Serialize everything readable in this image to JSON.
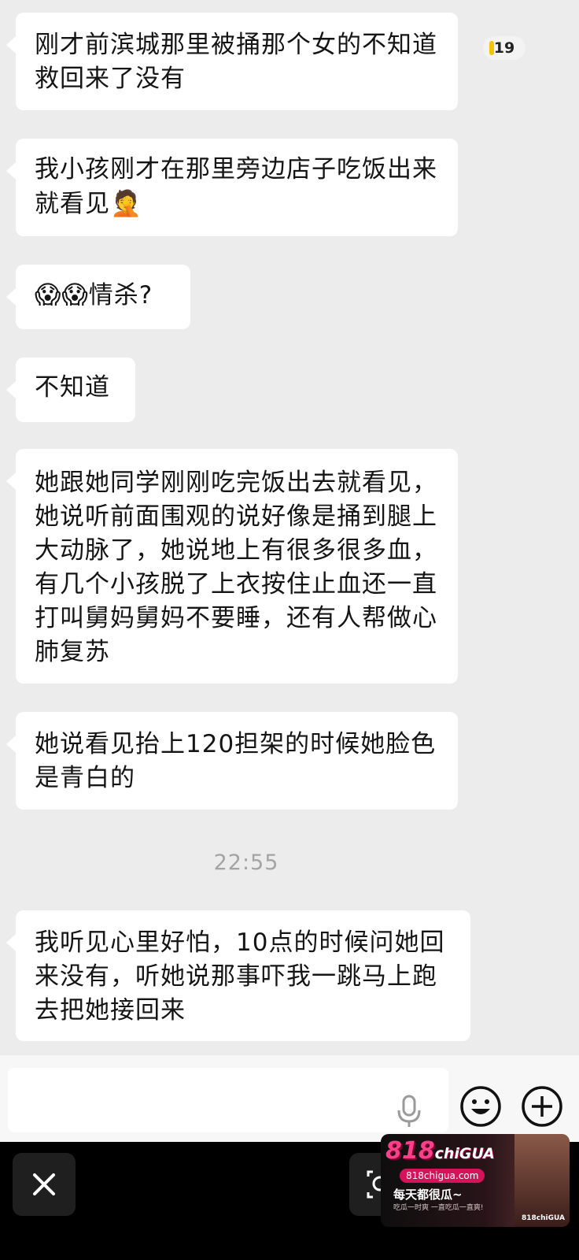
{
  "badge": {
    "count": "19"
  },
  "messages": [
    {
      "text": "刚才前滨城那里被捅那个女的不知道救回来了没有"
    },
    {
      "text": "我小孩刚才在那里旁边店子吃饭出来就看见",
      "emoji": "🤦"
    },
    {
      "emoji": "😱😱",
      "text": "情杀?"
    },
    {
      "text": "不知道"
    },
    {
      "text": "她跟她同学刚刚吃完饭出去就看见，她说听前面围观的说好像是捅到腿上大动脉了，她说地上有很多很多血，有几个小孩脱了上衣按住止血还一直打叫舅妈舅妈不要睡，还有人帮做心肺复苏"
    },
    {
      "text": "她说看见抬上120担架的时候她脸色是青白的"
    },
    {
      "text": "我听见心里好怕，10点的时候问她回来没有，听她说那事吓我一跳马上跑去把她接回来"
    }
  ],
  "timestamp": "22:55",
  "input_bar": {
    "icons": [
      "microphone-icon",
      "emoji-icon",
      "plus-icon"
    ]
  },
  "bottom_bar": {
    "icons": [
      "close-icon",
      "lens-search-icon"
    ]
  },
  "ad": {
    "logo_main": "818",
    "logo_sub": "chiGUA",
    "url": "818chigua.com",
    "slogan": "每天都很瓜~",
    "sub": "吃瓜一时爽 一直吃瓜一直爽!",
    "brand": "818chiGUA"
  },
  "colors": {
    "background": "#ececec",
    "bubble": "#ffffff",
    "bottom_bar": "#000000",
    "badge_accent": "#f5c400",
    "ad_accent": "#ff3f8a"
  }
}
